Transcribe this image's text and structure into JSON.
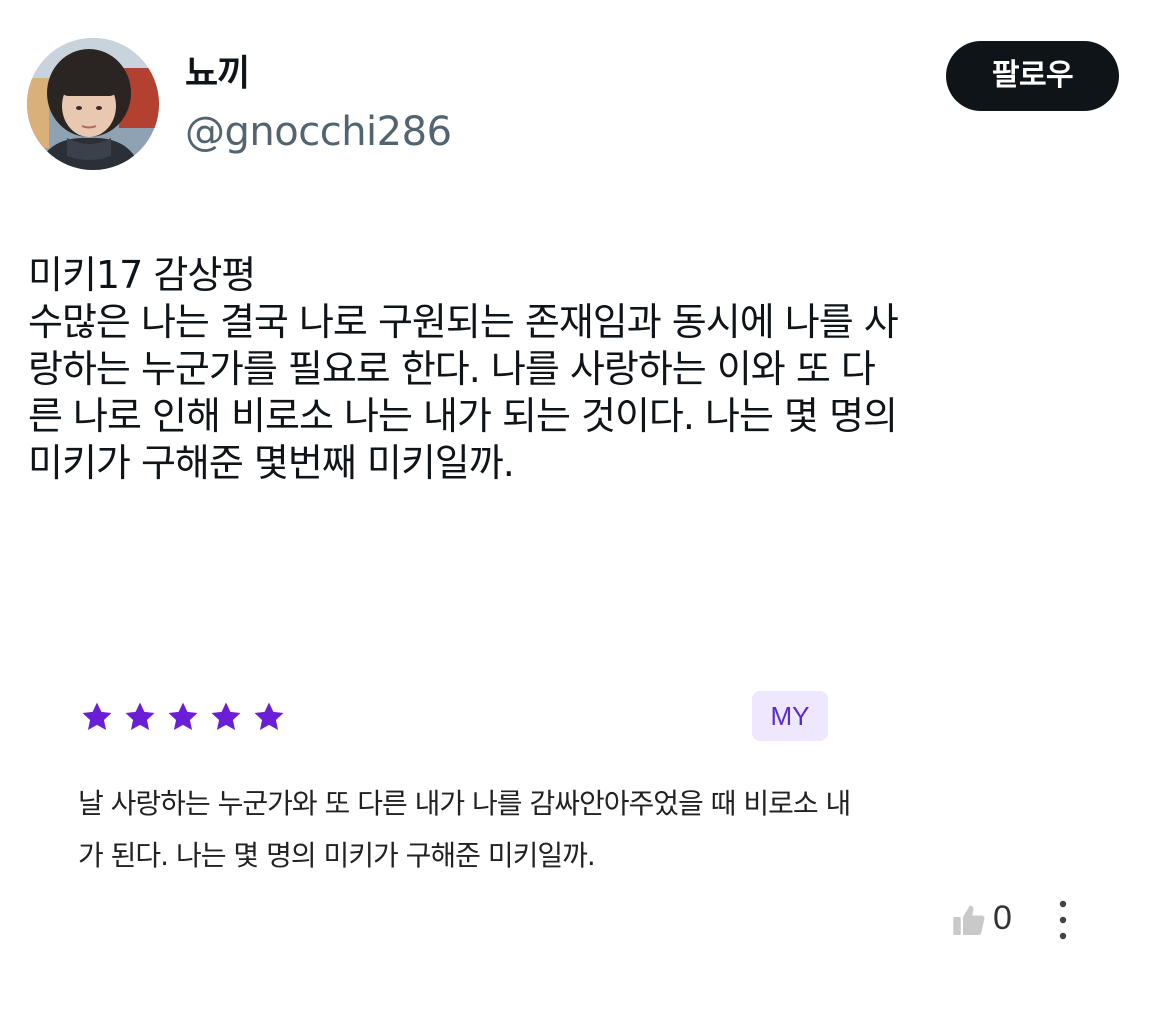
{
  "colors": {
    "follow_button_bg": "#0f1419",
    "handle_text": "#536471",
    "star": "#6a1fd6",
    "badge_bg": "#efe7fd",
    "badge_text": "#5b2bd0",
    "like_icon": "#c9c9c9"
  },
  "profile": {
    "avatar_icon": "profile-photo",
    "display_name": "뇨끼",
    "handle": "@gnocchi286",
    "follow_label": "팔로우"
  },
  "tweet": {
    "lines": [
      "미키17 감상평",
      "수많은 나는 결국 나로 구원되는 존재임과 동시에 나를 사",
      "랑하는 누군가를 필요로 한다. 나를 사랑하는 이와 또 다",
      "른 나로 인해 비로소 나는 내가 되는 것이다. 나는 몇 명의",
      "미키가 구해준 몇번째 미키일까."
    ]
  },
  "review": {
    "rating": 5,
    "rating_max": 5,
    "star_icon": "star-icon",
    "badge": "MY",
    "lines": [
      "날 사랑하는 누군가와 또 다른 내가 나를 감싸안아주었을 때 비로소 내",
      "가 된다. 나는 몇 명의 미키가 구해준 미키일까."
    ],
    "like_icon": "thumbs-up-icon",
    "like_count": "0",
    "more_icon": "more-vertical-icon"
  }
}
